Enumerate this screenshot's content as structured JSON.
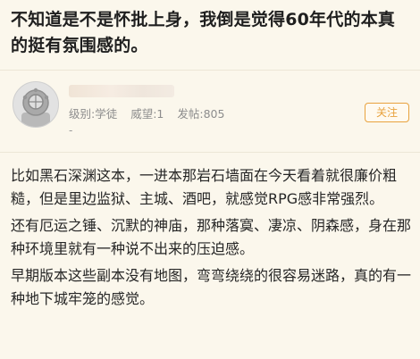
{
  "post": {
    "title": "不知道是不是怀批上身，我倒是觉得60年代的本真的挺有氛围感的。"
  },
  "poster": {
    "avatar_icon": "diving-helmet-avatar-icon",
    "username": "",
    "rank_label": "级别:学徒",
    "prestige_label": "威望:1",
    "posts_label": "发帖:805",
    "dash": "-",
    "follow_label": "关注"
  },
  "content": {
    "paragraphs": [
      "比如黑石深渊这本，一进本那岩石墙面在今天看着就很廉价粗糙，但是里边监狱、主城、酒吧，就感觉RPG感非常强烈。",
      "还有厄运之锤、沉默的神庙，那种落寞、凄凉、阴森感，身在那种环境里就有一种说不出来的压迫感。",
      "早期版本这些副本没有地图，弯弯绕绕的很容易迷路，真的有一种地下城牢笼的感觉。"
    ]
  },
  "colors": {
    "background": "#fbf7ec",
    "accent": "#e8a23e",
    "meta_text": "#8d8d8d"
  }
}
